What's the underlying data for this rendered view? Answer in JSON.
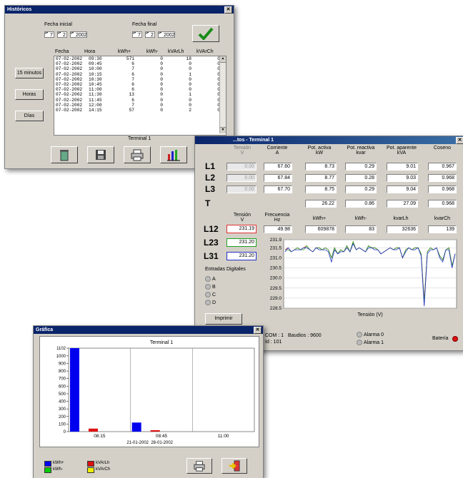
{
  "historicos": {
    "title": "Históricos",
    "fecha_inicial_label": "Fecha inicial",
    "fecha_final_label": "Fecha final",
    "start": {
      "day": "7",
      "month": "2",
      "year": "2002"
    },
    "end": {
      "day": "7",
      "month": "2",
      "year": "2002"
    },
    "columns": [
      "Fecha",
      "Hora",
      "kWh+",
      "kWh-",
      "kVArLh",
      "kVArCh"
    ],
    "rows": [
      [
        "07-02-2002",
        "09:30",
        "571",
        "0",
        "18",
        "0"
      ],
      [
        "07-02-2002",
        "09:45",
        "6",
        "0",
        "0",
        "0"
      ],
      [
        "07-02-2002",
        "10:00",
        "7",
        "0",
        "0",
        "0"
      ],
      [
        "07-02-2002",
        "10:15",
        "6",
        "0",
        "1",
        "0"
      ],
      [
        "07-02-2002",
        "10:30",
        "7",
        "0",
        "0",
        "0"
      ],
      [
        "07-02-2002",
        "10:45",
        "6",
        "0",
        "0",
        "0"
      ],
      [
        "07-02-2002",
        "11:00",
        "6",
        "0",
        "0",
        "0"
      ],
      [
        "07-02-2002",
        "11:30",
        "13",
        "0",
        "1",
        "0"
      ],
      [
        "07-02-2002",
        "11:45",
        "6",
        "0",
        "0",
        "0"
      ],
      [
        "07-02-2002",
        "12:00",
        "7",
        "0",
        "0",
        "0"
      ],
      [
        "07-02-2002",
        "14:15",
        "57",
        "0",
        "2",
        "0"
      ]
    ],
    "side_buttons": [
      "15 minutos",
      "Horas",
      "Días"
    ],
    "terminal_label": "Terminal 1"
  },
  "terminal": {
    "title": "...tos - Terminal 1",
    "col_headers": {
      "tension": "Tensión\nV",
      "corriente": "Corriente\nA",
      "pot_activa": "Pot. activa\nkW",
      "pot_reactiva": "Pot. reactiva\nkvar",
      "pot_aparente": "Pot. aparente\nkVA",
      "coseno": "Coseno"
    },
    "phases": [
      {
        "name": "L1",
        "tension": "0.00",
        "corriente": "67.60",
        "activa": "8.73",
        "reactiva": "0.29",
        "aparente": "9.01",
        "coseno": "0.967"
      },
      {
        "name": "L2",
        "tension": "0.00",
        "corriente": "67.84",
        "activa": "8.77",
        "reactiva": "0.28",
        "aparente": "9.03",
        "coseno": "0.968"
      },
      {
        "name": "L3",
        "tension": "0.00",
        "corriente": "67.70",
        "activa": "8.75",
        "reactiva": "0.29",
        "aparente": "9.04",
        "coseno": "0.968"
      }
    ],
    "total": {
      "name": "T",
      "activa": "26.22",
      "reactiva": "0.86",
      "aparente": "27.09",
      "coseno": "0.968"
    },
    "row2_headers": {
      "tension": "Tensión\nV",
      "frecuencia": "Frecuencia\nHz",
      "kwh_plus": "kWh+",
      "kwh_minus": "kWh-",
      "kvarlh": "kvarLh",
      "kvarch": "kvarCh"
    },
    "frecuencia": "49.98",
    "kwh_plus": "609878",
    "kwh_minus": "83",
    "kvarlh": "32636",
    "kvarch": "139",
    "line_voltages": [
      {
        "name": "L12",
        "value": "231.19",
        "color": "#e03030"
      },
      {
        "name": "L23",
        "value": "231.20",
        "color": "#20a020"
      },
      {
        "name": "L31",
        "value": "231.20",
        "color": "#2030c0"
      }
    ],
    "entradas_label": "Entradas Digitales",
    "entradas": [
      "A",
      "B",
      "C",
      "D"
    ],
    "imprimir_label": "Imprimir",
    "com_label": "COM : 1",
    "baudios_label": "Baudios : 9600",
    "id_label": "Id : 101",
    "alarma0": "Alarma 0",
    "alarma1": "Alarma 1",
    "bateria_label": "Batería"
  },
  "chart_data": [
    {
      "type": "line",
      "title": "",
      "xlabel": "Tensión (V)",
      "ylabel": "",
      "ylim": [
        228.5,
        231.9
      ],
      "yticks": [
        "231.9",
        "231.5",
        "231.0",
        "230.5",
        "230.0",
        "229.5",
        "229.0",
        "228.5"
      ],
      "series": [
        {
          "name": "L12",
          "color": "#e03030",
          "values": [
            231.4,
            231.5,
            231.3,
            231.4,
            231.5,
            231.4,
            231.5,
            231.6,
            231.4,
            231.3,
            231.5,
            231.5,
            231.4,
            231.5,
            231.4,
            231.0,
            231.5,
            231.2,
            231.4,
            231.3,
            231.6,
            231.3,
            231.8,
            231.4,
            231.5,
            231.4,
            231.3,
            231.6,
            231.5,
            231.5,
            231.4,
            231.2,
            231.3,
            231.4,
            231.5,
            231.4,
            231.5,
            231.5,
            231.0,
            231.4,
            231.5,
            231.4,
            231.5,
            231.5,
            231.2,
            228.9,
            231.3,
            231.5,
            231.4,
            231.5,
            231.1,
            230.9,
            231.4,
            231.5,
            230.6,
            231.2
          ]
        },
        {
          "name": "L23",
          "color": "#20a020",
          "values": [
            231.4,
            231.4,
            231.3,
            231.4,
            231.5,
            231.4,
            231.4,
            231.6,
            231.4,
            231.3,
            231.5,
            231.5,
            231.4,
            231.5,
            231.4,
            231.0,
            231.5,
            231.2,
            231.4,
            231.3,
            231.6,
            231.3,
            231.8,
            231.4,
            231.5,
            231.4,
            231.3,
            231.6,
            231.5,
            231.5,
            231.4,
            231.2,
            231.3,
            231.4,
            231.5,
            231.4,
            231.5,
            231.5,
            231.0,
            231.4,
            231.5,
            231.4,
            231.5,
            231.5,
            231.2,
            228.8,
            231.3,
            231.5,
            231.4,
            231.5,
            231.1,
            230.9,
            231.4,
            231.5,
            230.6,
            231.2
          ]
        },
        {
          "name": "L31",
          "color": "#2030c0",
          "values": [
            231.3,
            231.5,
            231.3,
            231.4,
            231.4,
            231.4,
            231.5,
            231.5,
            231.4,
            231.3,
            231.5,
            231.4,
            231.4,
            231.4,
            231.3,
            230.8,
            231.4,
            231.2,
            231.3,
            231.3,
            231.5,
            231.3,
            231.7,
            231.4,
            231.5,
            231.4,
            231.3,
            231.5,
            231.5,
            231.4,
            231.4,
            231.2,
            231.3,
            231.4,
            231.5,
            231.4,
            231.4,
            231.5,
            231.0,
            231.3,
            231.5,
            231.4,
            231.4,
            231.5,
            231.1,
            228.6,
            231.2,
            231.4,
            231.4,
            231.5,
            231.0,
            230.8,
            231.4,
            231.4,
            230.5,
            231.2
          ]
        }
      ]
    },
    {
      "type": "bar",
      "title": "Terminal 1",
      "categories": [
        "08:15",
        "08:45",
        "11:00"
      ],
      "ylim": [
        0,
        1102
      ],
      "yticks": [
        "1102",
        "1000",
        "900",
        "800",
        "700",
        "600",
        "500",
        "400",
        "300",
        "200",
        "100",
        "0"
      ],
      "date_labels": [
        "21-01-2002",
        "28-01-2002"
      ],
      "series": [
        {
          "name": "kWh+",
          "color": "#0000ee",
          "values": [
            1102,
            120,
            0
          ]
        },
        {
          "name": "kWh-",
          "color": "#00cc00",
          "values": [
            0,
            0,
            0
          ]
        },
        {
          "name": "kVArLh",
          "color": "#dd1111",
          "values": [
            40,
            4,
            0
          ]
        },
        {
          "name": "kVArCh",
          "color": "#eeee00",
          "values": [
            0,
            0,
            0
          ]
        }
      ]
    }
  ],
  "grafica": {
    "title": "Gráfica"
  }
}
